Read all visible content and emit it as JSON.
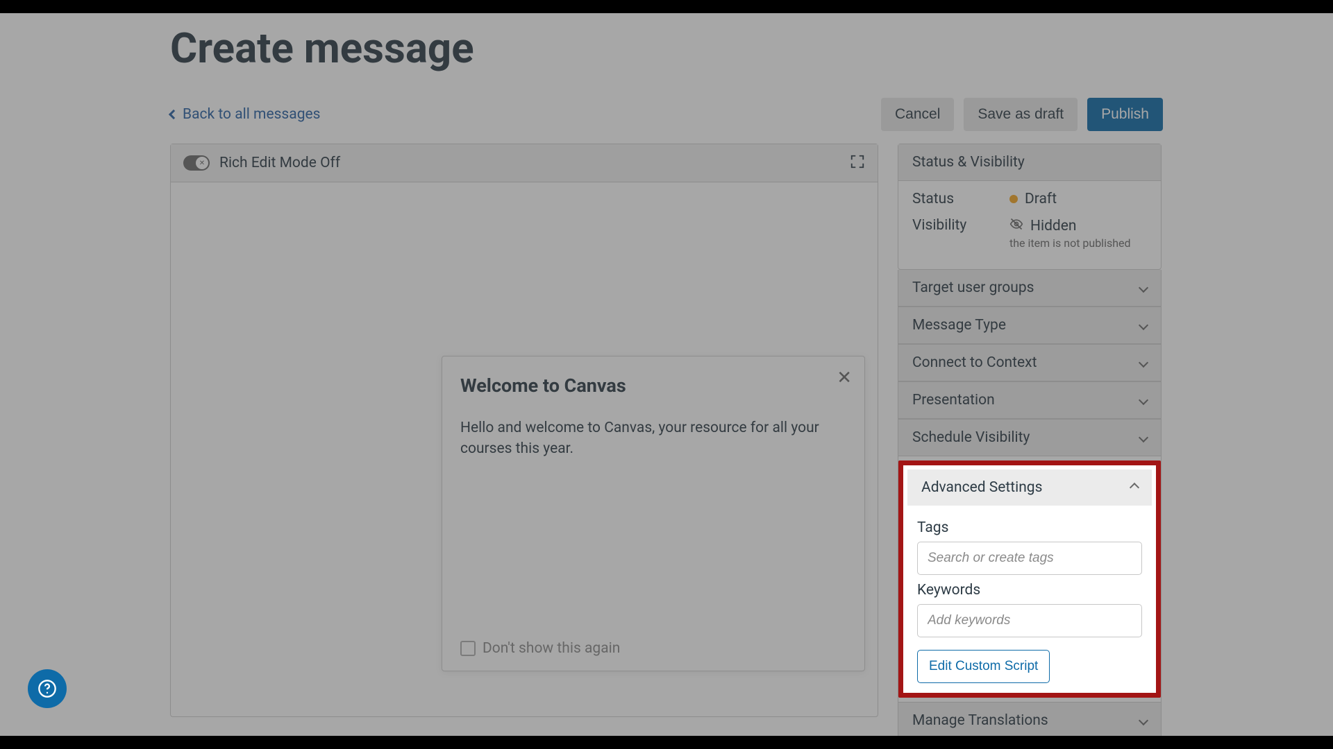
{
  "page": {
    "title": "Create message",
    "back_link": "Back to all messages"
  },
  "actions": {
    "cancel": "Cancel",
    "save_draft": "Save as draft",
    "publish": "Publish"
  },
  "editor": {
    "mode_label": "Rich Edit Mode Off"
  },
  "preview": {
    "title": "Welcome to Canvas",
    "body": "Hello and welcome to Canvas, your resource for all your courses this year.",
    "dont_show": "Don't show this again"
  },
  "sidebar": {
    "status_visibility": {
      "header": "Status & Visibility",
      "status_label": "Status",
      "status_value": "Draft",
      "visibility_label": "Visibility",
      "visibility_value": "Hidden",
      "visibility_sub": "the item is not published"
    },
    "sections": {
      "target_user_groups": "Target user groups",
      "message_type": "Message Type",
      "connect_to_context": "Connect to Context",
      "presentation": "Presentation",
      "schedule_visibility": "Schedule Visibility",
      "advanced_settings": "Advanced Settings",
      "manage_translations": "Manage Translations"
    },
    "advanced": {
      "tags_label": "Tags",
      "tags_placeholder": "Search or create tags",
      "keywords_label": "Keywords",
      "keywords_placeholder": "Add keywords",
      "edit_script": "Edit Custom Script"
    }
  }
}
